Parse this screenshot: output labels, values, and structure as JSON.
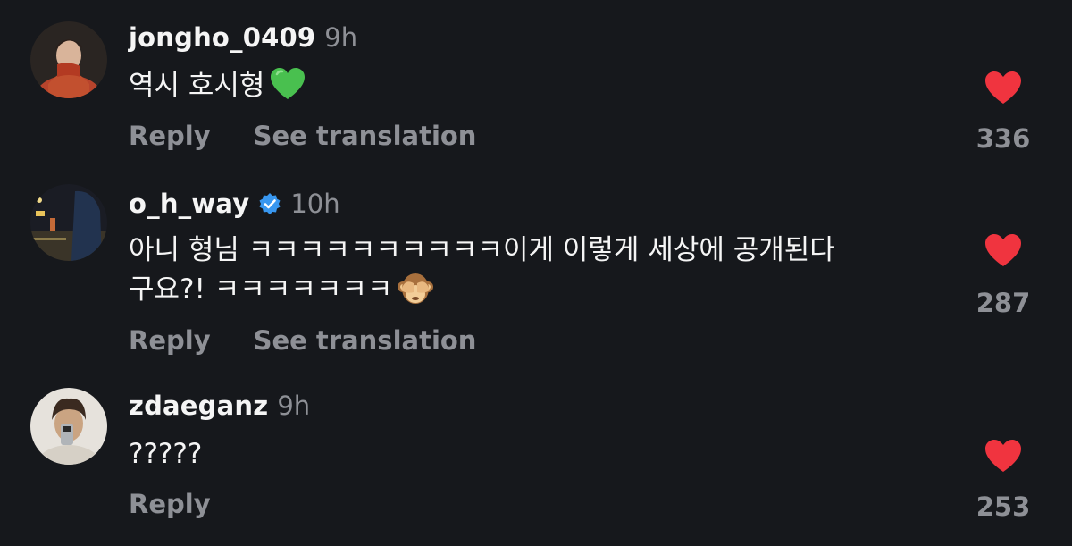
{
  "comments": [
    {
      "username": "jongho_0409",
      "verified": false,
      "time": "9h",
      "text": "역시 호시형",
      "emoji": "green-heart",
      "actions": {
        "reply": "Reply",
        "translation": "See translation"
      },
      "likes": "336",
      "avatar": "person-in-red-coat"
    },
    {
      "username": "o_h_way",
      "verified": true,
      "time": "10h",
      "text_line1": "아니 형님 ㅋㅋㅋㅋㅋㅋㅋㅋㅋㅋ이게 이렇게 세상에 공개된다",
      "text_line2": "구요?! ㅋㅋㅋㅋㅋㅋㅋ",
      "emoji": "see-no-evil-monkey",
      "actions": {
        "reply": "Reply",
        "translation": "See translation"
      },
      "likes": "287",
      "avatar": "night-street-scene"
    },
    {
      "username": "zdaeganz",
      "verified": false,
      "time": "9h",
      "text": "?????",
      "actions": {
        "reply": "Reply"
      },
      "likes": "253",
      "avatar": "person-with-phone-selfie"
    }
  ],
  "colors": {
    "background": "#16181c",
    "text": "#f5f5f5",
    "muted": "#8e9096",
    "heart": "#f0343f",
    "verified": "#3897f0"
  }
}
